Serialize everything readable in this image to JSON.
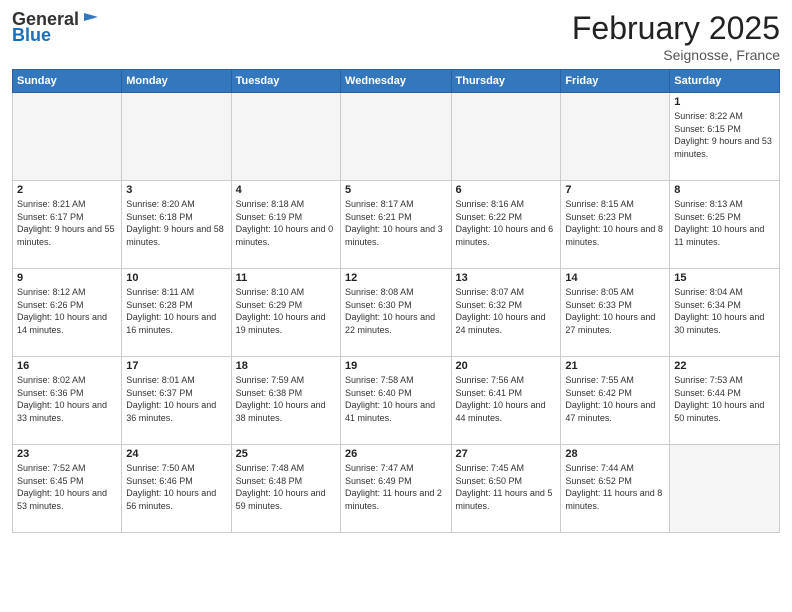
{
  "header": {
    "logo_general": "General",
    "logo_blue": "Blue",
    "month_title": "February 2025",
    "subtitle": "Seignosse, France"
  },
  "calendar": {
    "days_of_week": [
      "Sunday",
      "Monday",
      "Tuesday",
      "Wednesday",
      "Thursday",
      "Friday",
      "Saturday"
    ],
    "weeks": [
      [
        {
          "day": "",
          "info": ""
        },
        {
          "day": "",
          "info": ""
        },
        {
          "day": "",
          "info": ""
        },
        {
          "day": "",
          "info": ""
        },
        {
          "day": "",
          "info": ""
        },
        {
          "day": "",
          "info": ""
        },
        {
          "day": "1",
          "info": "Sunrise: 8:22 AM\nSunset: 6:15 PM\nDaylight: 9 hours and 53 minutes."
        }
      ],
      [
        {
          "day": "2",
          "info": "Sunrise: 8:21 AM\nSunset: 6:17 PM\nDaylight: 9 hours and 55 minutes."
        },
        {
          "day": "3",
          "info": "Sunrise: 8:20 AM\nSunset: 6:18 PM\nDaylight: 9 hours and 58 minutes."
        },
        {
          "day": "4",
          "info": "Sunrise: 8:18 AM\nSunset: 6:19 PM\nDaylight: 10 hours and 0 minutes."
        },
        {
          "day": "5",
          "info": "Sunrise: 8:17 AM\nSunset: 6:21 PM\nDaylight: 10 hours and 3 minutes."
        },
        {
          "day": "6",
          "info": "Sunrise: 8:16 AM\nSunset: 6:22 PM\nDaylight: 10 hours and 6 minutes."
        },
        {
          "day": "7",
          "info": "Sunrise: 8:15 AM\nSunset: 6:23 PM\nDaylight: 10 hours and 8 minutes."
        },
        {
          "day": "8",
          "info": "Sunrise: 8:13 AM\nSunset: 6:25 PM\nDaylight: 10 hours and 11 minutes."
        }
      ],
      [
        {
          "day": "9",
          "info": "Sunrise: 8:12 AM\nSunset: 6:26 PM\nDaylight: 10 hours and 14 minutes."
        },
        {
          "day": "10",
          "info": "Sunrise: 8:11 AM\nSunset: 6:28 PM\nDaylight: 10 hours and 16 minutes."
        },
        {
          "day": "11",
          "info": "Sunrise: 8:10 AM\nSunset: 6:29 PM\nDaylight: 10 hours and 19 minutes."
        },
        {
          "day": "12",
          "info": "Sunrise: 8:08 AM\nSunset: 6:30 PM\nDaylight: 10 hours and 22 minutes."
        },
        {
          "day": "13",
          "info": "Sunrise: 8:07 AM\nSunset: 6:32 PM\nDaylight: 10 hours and 24 minutes."
        },
        {
          "day": "14",
          "info": "Sunrise: 8:05 AM\nSunset: 6:33 PM\nDaylight: 10 hours and 27 minutes."
        },
        {
          "day": "15",
          "info": "Sunrise: 8:04 AM\nSunset: 6:34 PM\nDaylight: 10 hours and 30 minutes."
        }
      ],
      [
        {
          "day": "16",
          "info": "Sunrise: 8:02 AM\nSunset: 6:36 PM\nDaylight: 10 hours and 33 minutes."
        },
        {
          "day": "17",
          "info": "Sunrise: 8:01 AM\nSunset: 6:37 PM\nDaylight: 10 hours and 36 minutes."
        },
        {
          "day": "18",
          "info": "Sunrise: 7:59 AM\nSunset: 6:38 PM\nDaylight: 10 hours and 38 minutes."
        },
        {
          "day": "19",
          "info": "Sunrise: 7:58 AM\nSunset: 6:40 PM\nDaylight: 10 hours and 41 minutes."
        },
        {
          "day": "20",
          "info": "Sunrise: 7:56 AM\nSunset: 6:41 PM\nDaylight: 10 hours and 44 minutes."
        },
        {
          "day": "21",
          "info": "Sunrise: 7:55 AM\nSunset: 6:42 PM\nDaylight: 10 hours and 47 minutes."
        },
        {
          "day": "22",
          "info": "Sunrise: 7:53 AM\nSunset: 6:44 PM\nDaylight: 10 hours and 50 minutes."
        }
      ],
      [
        {
          "day": "23",
          "info": "Sunrise: 7:52 AM\nSunset: 6:45 PM\nDaylight: 10 hours and 53 minutes."
        },
        {
          "day": "24",
          "info": "Sunrise: 7:50 AM\nSunset: 6:46 PM\nDaylight: 10 hours and 56 minutes."
        },
        {
          "day": "25",
          "info": "Sunrise: 7:48 AM\nSunset: 6:48 PM\nDaylight: 10 hours and 59 minutes."
        },
        {
          "day": "26",
          "info": "Sunrise: 7:47 AM\nSunset: 6:49 PM\nDaylight: 11 hours and 2 minutes."
        },
        {
          "day": "27",
          "info": "Sunrise: 7:45 AM\nSunset: 6:50 PM\nDaylight: 11 hours and 5 minutes."
        },
        {
          "day": "28",
          "info": "Sunrise: 7:44 AM\nSunset: 6:52 PM\nDaylight: 11 hours and 8 minutes."
        },
        {
          "day": "",
          "info": ""
        }
      ]
    ]
  }
}
